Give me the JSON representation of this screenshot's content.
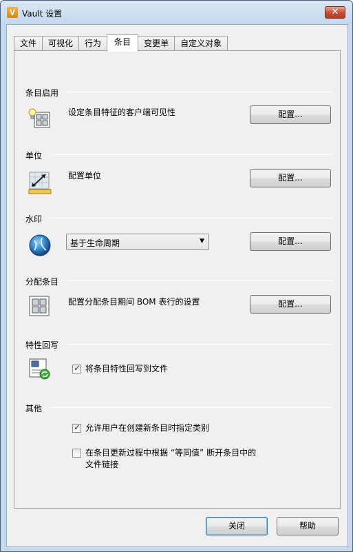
{
  "window": {
    "title": "Vault 设置",
    "app_icon_letter": "V",
    "close_glyph": "✕"
  },
  "tabs": [
    {
      "label": "文件",
      "active": false
    },
    {
      "label": "可视化",
      "active": false
    },
    {
      "label": "行为",
      "active": false
    },
    {
      "label": "条目",
      "active": true
    },
    {
      "label": "变更单",
      "active": false
    },
    {
      "label": "自定义对象",
      "active": false
    }
  ],
  "sections": {
    "item_enable": {
      "label": "条目启用",
      "description": "设定条目特征的客户端可见性",
      "button": "配置...",
      "icon": "lightbulb-grid-icon"
    },
    "units": {
      "label": "单位",
      "description": "配置单位",
      "button": "配置...",
      "icon": "ruler-measure-icon"
    },
    "watermark": {
      "label": "水印",
      "dropdown_value": "基于生命周期",
      "button": "配置...",
      "icon": "globe-icon"
    },
    "assign_items": {
      "label": "分配条目",
      "description": "配置分配条目期间 BOM 表行的设置",
      "button": "配置...",
      "icon": "grid-icon"
    },
    "property_writeback": {
      "label": "特性回写",
      "checkbox_label": "将条目特性回写到文件",
      "checked": true,
      "icon": "writeback-sync-icon"
    },
    "other": {
      "label": "其他",
      "checkbox1_label": "允许用户在创建新条目时指定类别",
      "checkbox1_checked": true,
      "checkbox2_label_line1": "在条目更新过程中根据 “等同值” 断开条目中的",
      "checkbox2_label_line2": "文件链接",
      "checkbox2_checked": false
    }
  },
  "footer": {
    "close_label": "关闭",
    "help_label": "帮助"
  }
}
